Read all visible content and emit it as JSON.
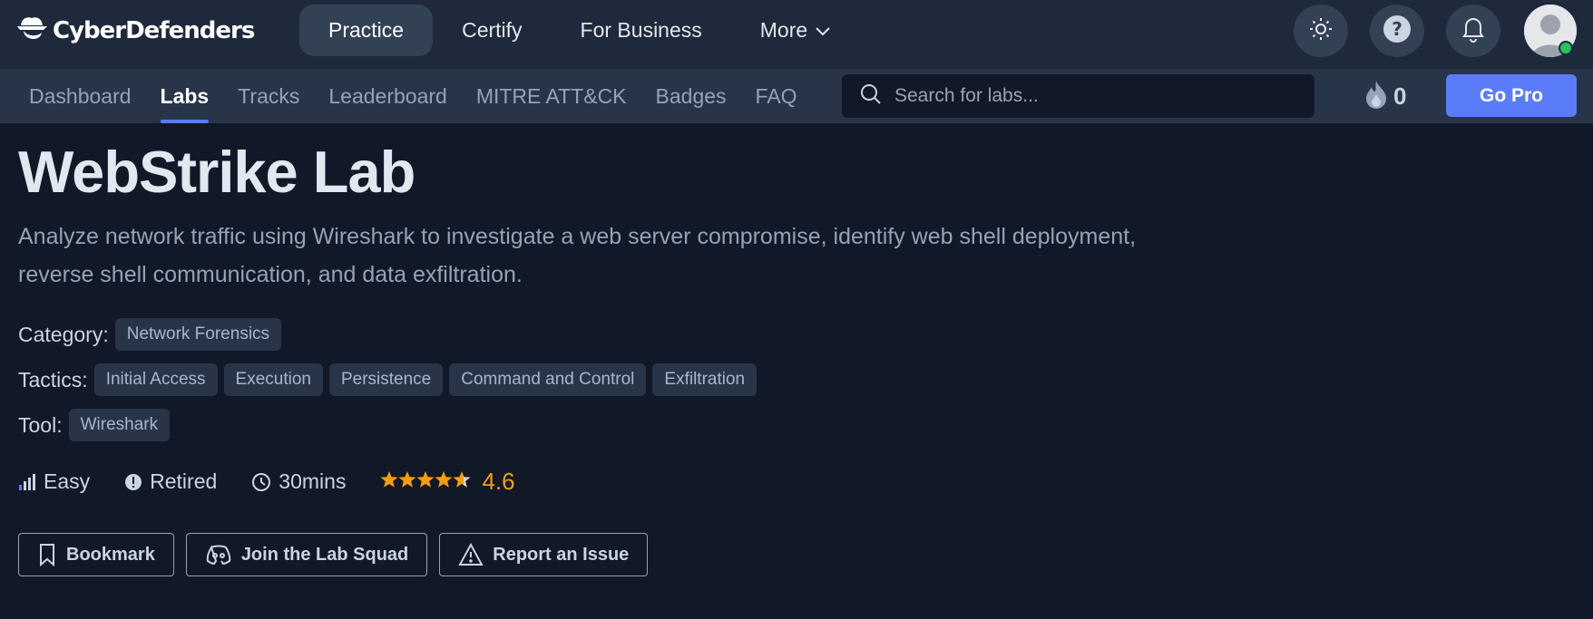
{
  "header": {
    "brand": "CyberDefenders",
    "nav": [
      {
        "label": "Practice",
        "active": true
      },
      {
        "label": "Certify"
      },
      {
        "label": "For Business"
      },
      {
        "label": "More",
        "icon": "chevron-down-icon"
      }
    ],
    "icons": [
      "theme-toggle-sun-icon",
      "help-icon",
      "notifications-bell-icon",
      "user-avatar"
    ]
  },
  "subnav": {
    "tabs": [
      {
        "label": "Dashboard"
      },
      {
        "label": "Labs",
        "active": true
      },
      {
        "label": "Tracks"
      },
      {
        "label": "Leaderboard"
      },
      {
        "label": "MITRE ATT&CK"
      },
      {
        "label": "Badges"
      },
      {
        "label": "FAQ"
      }
    ],
    "search_placeholder": "Search for labs...",
    "streak_count": "0",
    "go_pro": "Go Pro"
  },
  "lab": {
    "title": "WebStrike Lab",
    "description": "Analyze network traffic using Wireshark to investigate a web server compromise, identify web shell deployment, reverse shell communication, and data exfiltration.",
    "category_label": "Category:",
    "category": "Network Forensics",
    "tactics_label": "Tactics:",
    "tactics": [
      "Initial Access",
      "Execution",
      "Persistence",
      "Command and Control",
      "Exfiltration"
    ],
    "tool_label": "Tool:",
    "tool": "Wireshark",
    "difficulty": "Easy",
    "status": "Retired",
    "duration": "30mins",
    "rating": "4.6",
    "rating_stars": 4.6
  },
  "actions": {
    "bookmark": "Bookmark",
    "join": "Join the Lab Squad",
    "report": "Report an Issue"
  },
  "colors": {
    "accent": "#5b7cfa",
    "star": "#f59e0b",
    "online": "#22c55e"
  }
}
